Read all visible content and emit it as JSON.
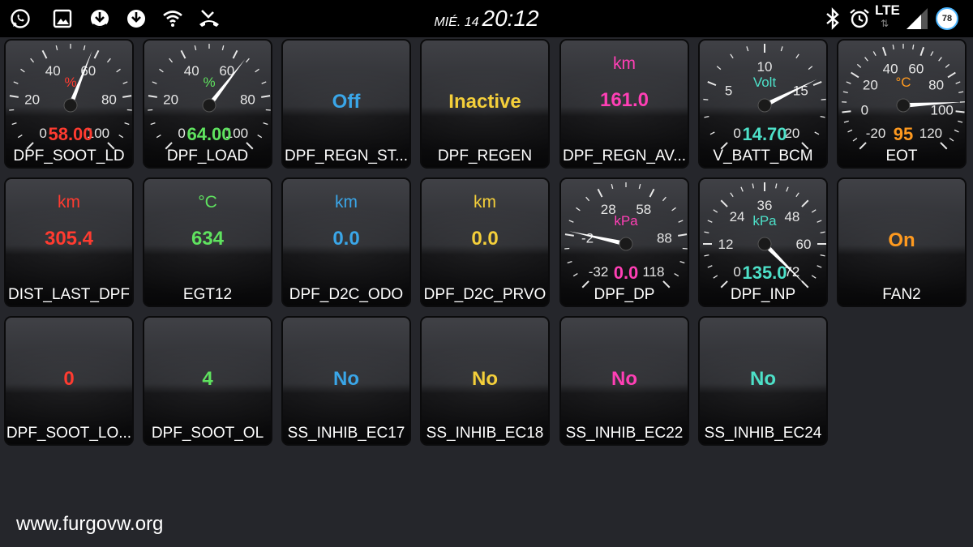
{
  "status_bar": {
    "left_icons": [
      "whatsapp-icon",
      "gallery-icon",
      "download-icon",
      "download-alt-icon",
      "wifi-icon",
      "missed-call-icon"
    ],
    "date": "MIÉ. 14",
    "time": "20:12",
    "right_icons": [
      "bluetooth-icon",
      "alarm-icon",
      "signal-icon"
    ],
    "network": "LTE",
    "network_arrows": "⇅",
    "battery": "78"
  },
  "gauges": [
    {
      "id": "dpf_soot_ld",
      "label": "DPF_SOOT_LD",
      "unit": "%",
      "value": "58.00",
      "color": "#ff3b30",
      "ticks": [
        "0",
        "20",
        "40",
        "60",
        "80",
        "100"
      ]
    },
    {
      "id": "dpf_load",
      "label": "DPF_LOAD",
      "unit": "%",
      "value": "64.00",
      "color": "#5fe35f",
      "ticks": [
        "0",
        "20",
        "40",
        "60",
        "80",
        "100"
      ]
    },
    {
      "id": "v_batt_bcm",
      "label": "V_BATT_BCM",
      "unit": "Volt",
      "value": "14.70",
      "color": "#4de0c8",
      "ticks": [
        "0",
        "5",
        "10",
        "15",
        "20"
      ]
    },
    {
      "id": "eot",
      "label": "EOT",
      "unit": "°C",
      "value": "95",
      "color": "#ff9a1f",
      "ticks": [
        "-20",
        "0",
        "20",
        "40",
        "60",
        "80",
        "100",
        "120"
      ]
    },
    {
      "id": "dpf_dp",
      "label": "DPF_DP",
      "unit": "kPa",
      "value": "0.0",
      "color": "#ff3fb5",
      "ticks": [
        "-32",
        "-2",
        "28",
        "58",
        "88",
        "118"
      ]
    },
    {
      "id": "dpf_inp",
      "label": "DPF_INP",
      "unit": "kPa",
      "value": "135.0",
      "color": "#4de0c8",
      "ticks": [
        "0",
        "12",
        "24",
        "36",
        "48",
        "60",
        "72"
      ]
    }
  ],
  "tiles": [
    {
      "id": "dpf_regn_st",
      "label": "DPF_REGN_ST...",
      "unit": "",
      "value": "Off",
      "color": "#3aa6e8"
    },
    {
      "id": "dpf_regen",
      "label": "DPF_REGEN",
      "unit": "",
      "value": "Inactive",
      "color": "#f4cf3a"
    },
    {
      "id": "dpf_regn_av",
      "label": "DPF_REGN_AV...",
      "unit": "km",
      "value": "161.0",
      "color": "#ff3fb5"
    },
    {
      "id": "dist_last_dpf",
      "label": "DIST_LAST_DPF",
      "unit": "km",
      "value": "305.4",
      "color": "#ff3b30"
    },
    {
      "id": "egt12",
      "label": "EGT12",
      "unit": "°C",
      "value": "634",
      "color": "#5fe35f"
    },
    {
      "id": "dpf_d2c_odo",
      "label": "DPF_D2C_ODO",
      "unit": "km",
      "value": "0.0",
      "color": "#3aa6e8"
    },
    {
      "id": "dpf_d2c_prvo",
      "label": "DPF_D2C_PRVO",
      "unit": "km",
      "value": "0.0",
      "color": "#f4cf3a"
    },
    {
      "id": "fan2",
      "label": "FAN2",
      "unit": "",
      "value": "On",
      "color": "#ff9a1f"
    },
    {
      "id": "dpf_soot_lo",
      "label": "DPF_SOOT_LO...",
      "unit": "",
      "value": "0",
      "color": "#ff3b30"
    },
    {
      "id": "dpf_soot_ol",
      "label": "DPF_SOOT_OL",
      "unit": "",
      "value": "4",
      "color": "#5fe35f"
    },
    {
      "id": "ss_inhib_ec17",
      "label": "SS_INHIB_EC17",
      "unit": "",
      "value": "No",
      "color": "#3aa6e8"
    },
    {
      "id": "ss_inhib_ec18",
      "label": "SS_INHIB_EC18",
      "unit": "",
      "value": "No",
      "color": "#f4cf3a"
    },
    {
      "id": "ss_inhib_ec22",
      "label": "SS_INHIB_EC22",
      "unit": "",
      "value": "No",
      "color": "#ff3fb5"
    },
    {
      "id": "ss_inhib_ec24",
      "label": "SS_INHIB_EC24",
      "unit": "",
      "value": "No",
      "color": "#4de0c8"
    }
  ],
  "watermark": "www.furgovw.org"
}
